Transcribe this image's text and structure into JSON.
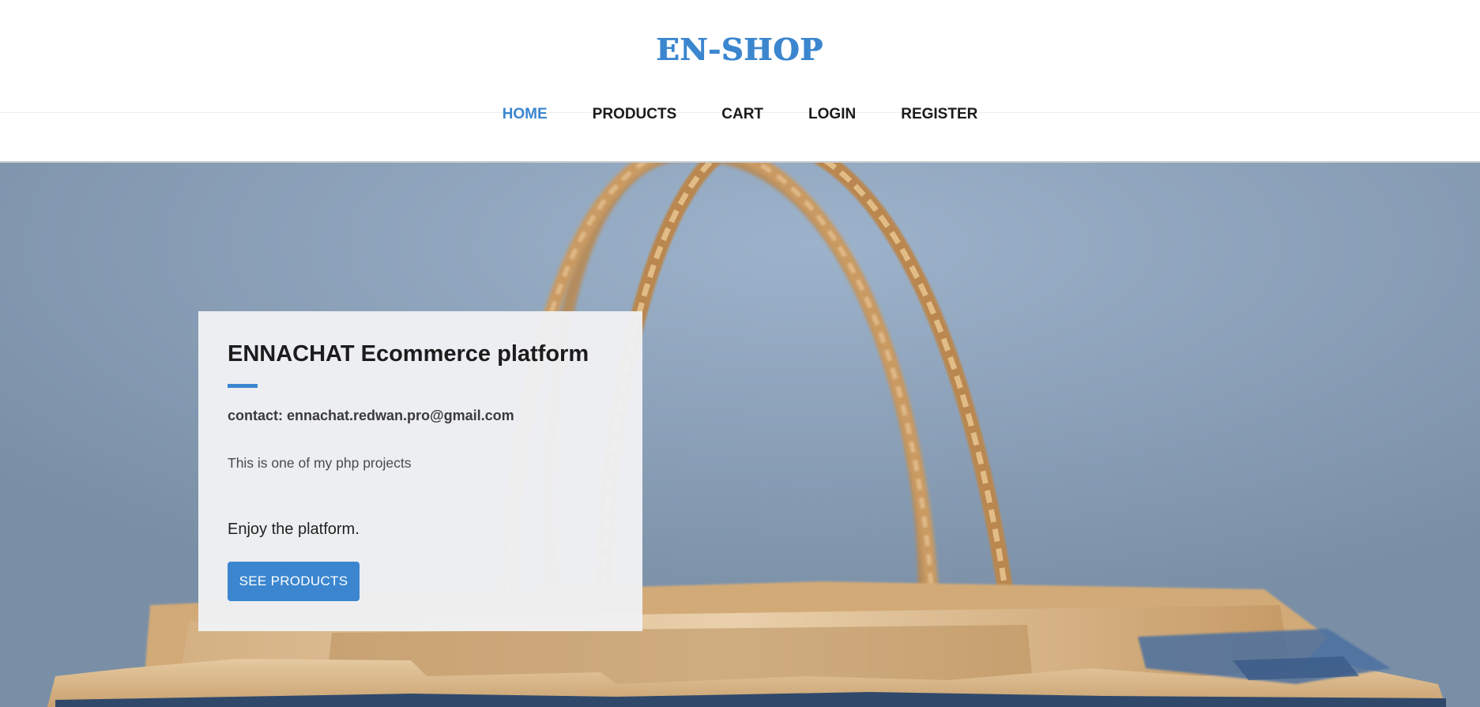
{
  "header": {
    "logo": "EN-SHOP"
  },
  "nav": {
    "items": [
      {
        "label": "HOME",
        "active": true
      },
      {
        "label": "PRODUCTS",
        "active": false
      },
      {
        "label": "CART",
        "active": false
      },
      {
        "label": "LOGIN",
        "active": false
      },
      {
        "label": "REGISTER",
        "active": false
      }
    ]
  },
  "hero": {
    "background_image": "paper-shopping-bag-photo",
    "card": {
      "title": "ENNACHAT Ecommerce platform",
      "contact": "contact: ennachat.redwan.pro@gmail.com",
      "description": "This is one of my php projects",
      "tagline": "Enjoy the platform.",
      "button_label": "SEE PRODUCTS"
    }
  },
  "colors": {
    "accent": "#3b86cf",
    "text_dark": "#1c1c1c",
    "card_bg": "#f0f1f3",
    "hero_bg": "#8aa0b8"
  }
}
